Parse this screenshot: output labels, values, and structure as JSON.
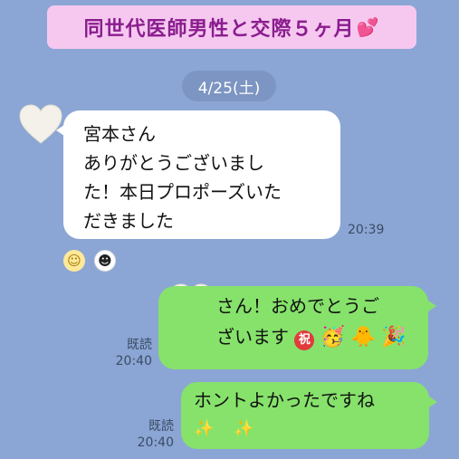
{
  "banner": {
    "title": "同世代医師男性と交際５ヶ月",
    "heart": "💕"
  },
  "date_divider": "4/25(土)",
  "incoming": {
    "lines": [
      "宮本さん",
      "ありがとうございまし",
      "た！本日プロポーズいた",
      "だきました"
    ],
    "time": "20:39",
    "reactions": [
      "smile-emoji",
      "hand-over-mouth-emoji"
    ]
  },
  "outgoing": [
    {
      "line1": "さん！おめでとうご",
      "line2": "ざいます",
      "stickers": [
        "iwai-badge",
        "party-emoji",
        "chick-emoji",
        "confetti-emoji"
      ],
      "iwai": "祝",
      "read": "既読",
      "time": "20:40"
    },
    {
      "line1": "ホントよかったですね",
      "sparkles": "✨ ✨",
      "read": "既読",
      "time": "20:40"
    }
  ],
  "colors": {
    "background": "#8ba6d4",
    "banner_bg": "#f6c8f0",
    "banner_text": "#8a1d8e",
    "outgoing_bubble": "#86e26b",
    "incoming_bubble": "#ffffff"
  }
}
